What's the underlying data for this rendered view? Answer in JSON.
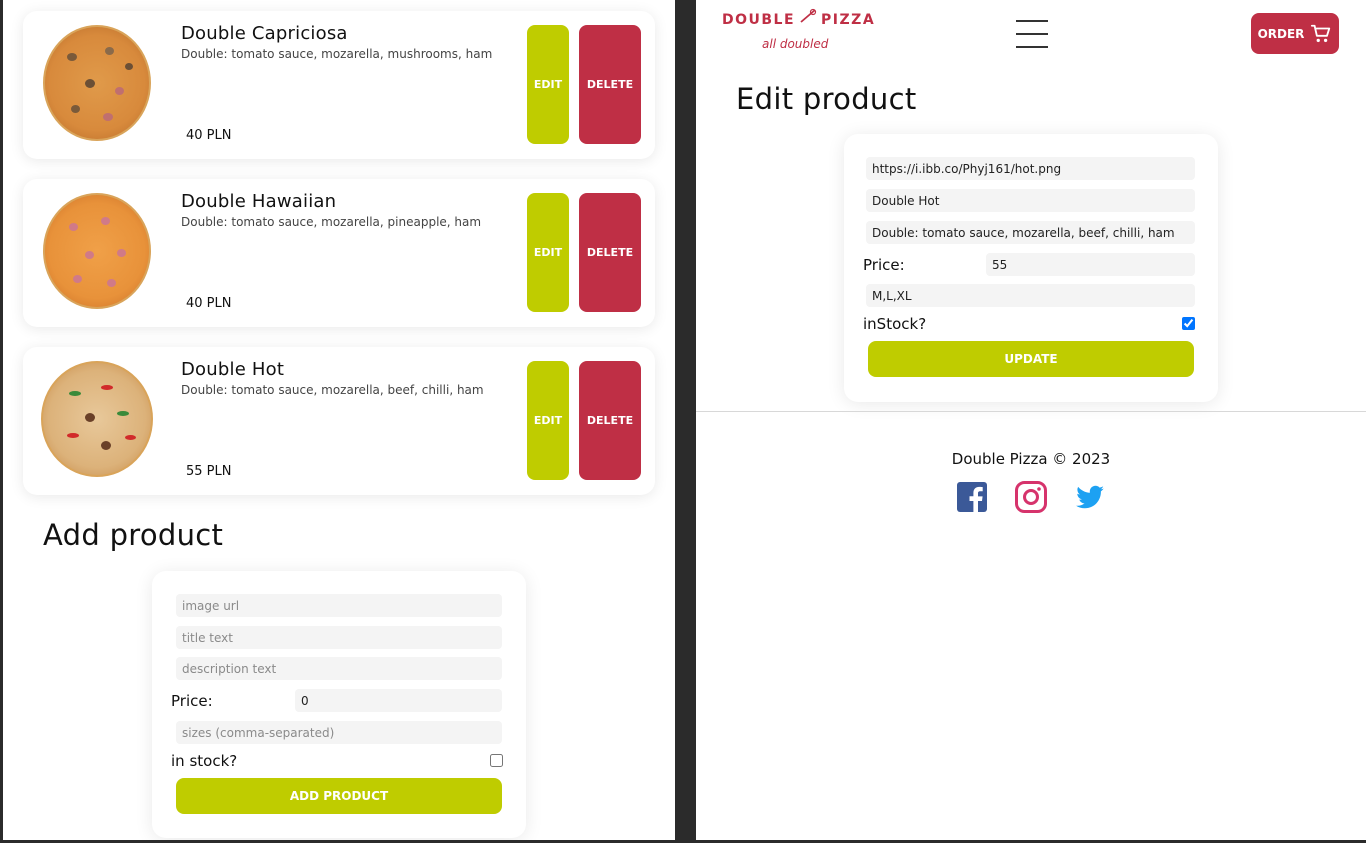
{
  "products": [
    {
      "title": "Double Capriciosa",
      "description": "Double: tomato sauce, mozarella, mushrooms, ham",
      "price": "40 PLN",
      "edit_label": "EDIT",
      "delete_label": "DELETE"
    },
    {
      "title": "Double Hawaiian",
      "description": "Double: tomato sauce, mozarella, pineapple, ham",
      "price": "40 PLN",
      "edit_label": "EDIT",
      "delete_label": "DELETE"
    },
    {
      "title": "Double Hot",
      "description": "Double: tomato sauce, mozarella, beef, chilli, ham",
      "price": "55 PLN",
      "edit_label": "EDIT",
      "delete_label": "DELETE"
    }
  ],
  "add_product": {
    "title": "Add product",
    "image_placeholder": "image url",
    "title_placeholder": "title text",
    "description_placeholder": "description text",
    "price_label": "Price:",
    "price_value": "0",
    "sizes_placeholder": "sizes (comma-separated)",
    "stock_label": "in stock?",
    "in_stock": false,
    "button_label": "ADD PRODUCT"
  },
  "header": {
    "logo_left": "DOUBLE",
    "logo_right": "PIZZA",
    "logo_tagline": "all doubled",
    "order_label": "ORDER",
    "cart_icon": "cart-icon",
    "menu_icon": "hamburger-menu-icon"
  },
  "edit_product": {
    "title": "Edit product",
    "image_value": "https://i.ibb.co/Phyj161/hot.png",
    "title_value": "Double Hot",
    "description_value": "Double: tomato sauce, mozarella, beef, chilli, ham",
    "price_label": "Price:",
    "price_value": "55",
    "sizes_value": "M,L,XL",
    "stock_label": "inStock?",
    "in_stock": true,
    "button_label": "UPDATE"
  },
  "footer": {
    "copyright": "Double Pizza © 2023",
    "social_icons": [
      "facebook-icon",
      "instagram-icon",
      "twitter-icon"
    ]
  },
  "colors": {
    "brand_red": "#bf2f45",
    "accent_lime": "#bfcc00",
    "facebook_blue": "#3b5998",
    "instagram_pink": "#d6336c",
    "twitter_blue": "#1da1f2"
  }
}
